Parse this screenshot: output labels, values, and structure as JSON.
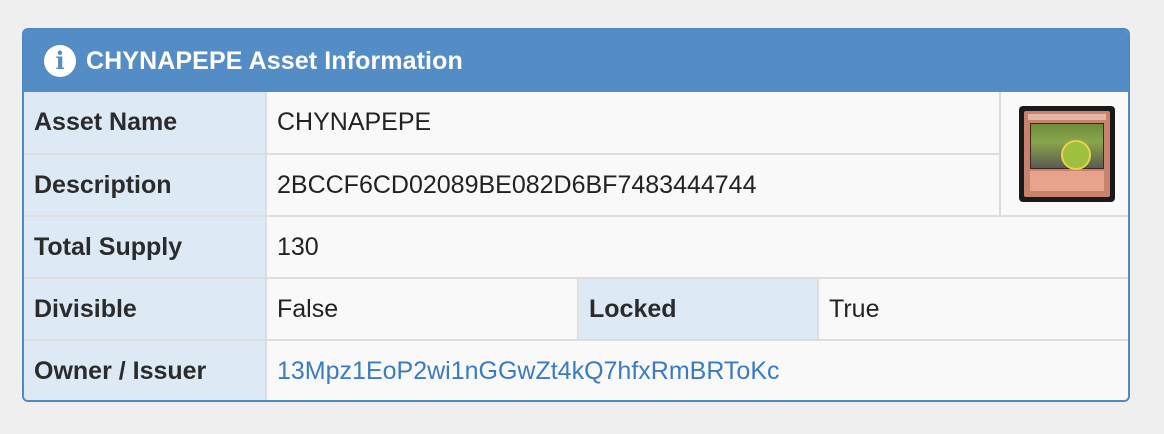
{
  "panel": {
    "title": "CHYNAPEPE Asset Information",
    "icon": "info-icon"
  },
  "rows": {
    "asset_name": {
      "label": "Asset Name",
      "value": "CHYNAPEPE"
    },
    "description": {
      "label": "Description",
      "value": "2BCCF6CD02089BE082D6BF7483444744"
    },
    "total_supply": {
      "label": "Total Supply",
      "value": "130"
    },
    "divisible": {
      "label": "Divisible",
      "value": "False"
    },
    "locked": {
      "label": "Locked",
      "value": "True"
    },
    "owner": {
      "label": "Owner / Issuer",
      "value": "13Mpz1EoP2wi1nGGwZt4kQ7hfxRmBRToKc"
    }
  },
  "colors": {
    "header": "#548cc6",
    "label_bg": "#ddeaf6",
    "link": "#3b7bbf"
  }
}
